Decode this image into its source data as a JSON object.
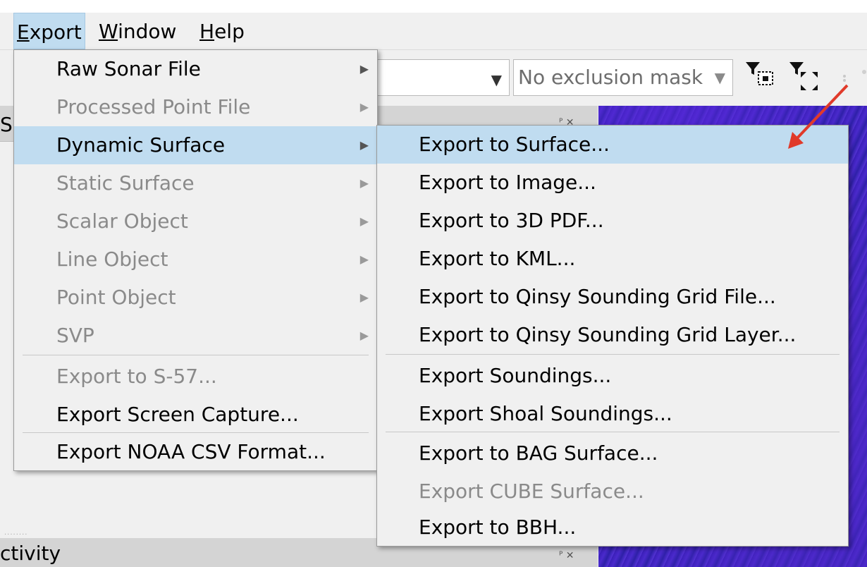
{
  "menubar": {
    "items": [
      {
        "mnemonic": "E",
        "rest": "xport",
        "active": true
      },
      {
        "mnemonic": "W",
        "rest": "indow",
        "active": false
      },
      {
        "mnemonic": "H",
        "rest": "elp",
        "active": false
      }
    ]
  },
  "toolbar": {
    "mask_combo_value": "No exclusion mask",
    "combo_arrow": "▼"
  },
  "panels": {
    "top_panel_title_fragment": "Sc",
    "bottom_panel_title_fragment": "ctivity",
    "dock_buttons": "ᴾ ✕"
  },
  "export_menu": {
    "items": [
      {
        "label": "Raw Sonar File",
        "enabled": true,
        "submenu": true
      },
      {
        "label": "Processed Point File",
        "enabled": false,
        "submenu": true
      },
      {
        "label": "Dynamic Surface",
        "enabled": true,
        "submenu": true,
        "highlighted": true
      },
      {
        "label": "Static Surface",
        "enabled": false,
        "submenu": true
      },
      {
        "label": "Scalar Object",
        "enabled": false,
        "submenu": true
      },
      {
        "label": "Line Object",
        "enabled": false,
        "submenu": true
      },
      {
        "label": "Point Object",
        "enabled": false,
        "submenu": true
      },
      {
        "label": "SVP",
        "enabled": false,
        "submenu": true
      },
      {
        "label": "Export to S-57...",
        "enabled": false,
        "submenu": false
      },
      {
        "label": "Export Screen Capture...",
        "enabled": true,
        "submenu": false
      },
      {
        "label": "Export NOAA CSV Format...",
        "enabled": true,
        "submenu": false
      }
    ],
    "submenu_glyph": "▶"
  },
  "dynamic_surface_submenu": {
    "items": [
      {
        "label": "Export to Surface...",
        "enabled": true,
        "highlighted": true
      },
      {
        "label": "Export to Image...",
        "enabled": true
      },
      {
        "label": "Export to 3D PDF...",
        "enabled": true
      },
      {
        "label": "Export to KML...",
        "enabled": true
      },
      {
        "label": "Export to Qinsy Sounding Grid File...",
        "enabled": true
      },
      {
        "label": "Export to Qinsy Sounding Grid Layer...",
        "enabled": true
      },
      {
        "label": "Export Soundings...",
        "enabled": true
      },
      {
        "label": "Export Shoal Soundings...",
        "enabled": true
      },
      {
        "label": "Export to BAG Surface...",
        "enabled": true
      },
      {
        "label": "Export CUBE Surface...",
        "enabled": false
      },
      {
        "label": "Export to BBH...",
        "enabled": true
      }
    ]
  },
  "colors": {
    "highlight": "#c0dcf0",
    "disabled_text": "#8a8a8a",
    "annotation_arrow": "#e03a2a"
  }
}
